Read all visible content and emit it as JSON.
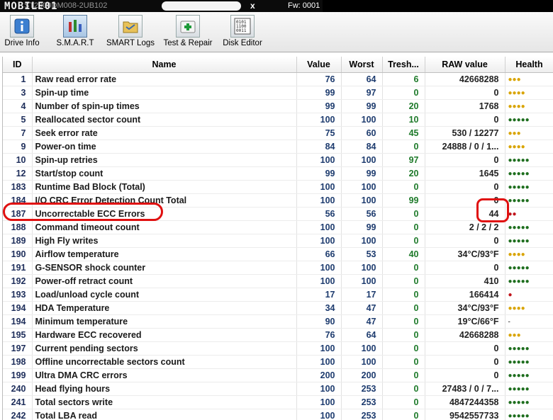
{
  "titlebar": {
    "logo": "MOBILE01",
    "device": "ST2000DM008-2UB102",
    "close_glyph": "x",
    "firmware": "Fw: 0001"
  },
  "toolbar": {
    "buttons": [
      {
        "label": "Drive Info",
        "icon": "info-icon"
      },
      {
        "label": "S.M.A.R.T",
        "icon": "smart-bars-icon"
      },
      {
        "label": "SMART Logs",
        "icon": "folder-icon"
      },
      {
        "label": "Test & Repair",
        "icon": "first-aid-icon"
      },
      {
        "label": "Disk Editor",
        "icon": "binary-editor-icon"
      }
    ]
  },
  "table": {
    "headers": [
      "ID",
      "Name",
      "Value",
      "Worst",
      "Tresh...",
      "RAW value",
      "Health"
    ],
    "rows": [
      {
        "id": "1",
        "name": "Raw read error rate",
        "value": "76",
        "worst": "64",
        "thresh": "6",
        "raw": "42668288",
        "health": "●●●",
        "hcolor": "yellow",
        "ncolor": "green"
      },
      {
        "id": "3",
        "name": "Spin-up time",
        "value": "99",
        "worst": "97",
        "thresh": "0",
        "raw": "0",
        "health": "●●●●",
        "hcolor": "yellow",
        "ncolor": "green"
      },
      {
        "id": "4",
        "name": "Number of spin-up times",
        "value": "99",
        "worst": "99",
        "thresh": "20",
        "raw": "1768",
        "health": "●●●●",
        "hcolor": "yellow",
        "ncolor": "black"
      },
      {
        "id": "5",
        "name": "Reallocated sector count",
        "value": "100",
        "worst": "100",
        "thresh": "10",
        "raw": "0",
        "health": "●●●●●",
        "hcolor": "green",
        "ncolor": "purple"
      },
      {
        "id": "7",
        "name": "Seek error rate",
        "value": "75",
        "worst": "60",
        "thresh": "45",
        "raw": "530 / 12277",
        "health": "●●●",
        "hcolor": "yellow",
        "ncolor": "green"
      },
      {
        "id": "9",
        "name": "Power-on time",
        "value": "84",
        "worst": "84",
        "thresh": "0",
        "raw": "24888 / 0 / 1...",
        "health": "●●●●",
        "hcolor": "yellow",
        "ncolor": "black"
      },
      {
        "id": "10",
        "name": "Spin-up retries",
        "value": "100",
        "worst": "100",
        "thresh": "97",
        "raw": "0",
        "health": "●●●●●",
        "hcolor": "green",
        "ncolor": "green"
      },
      {
        "id": "12",
        "name": "Start/stop count",
        "value": "99",
        "worst": "99",
        "thresh": "20",
        "raw": "1645",
        "health": "●●●●●",
        "hcolor": "green",
        "ncolor": "black"
      },
      {
        "id": "183",
        "name": "Runtime Bad Block (Total)",
        "value": "100",
        "worst": "100",
        "thresh": "0",
        "raw": "0",
        "health": "●●●●●",
        "hcolor": "green",
        "ncolor": "black"
      },
      {
        "id": "184",
        "name": "I/O CRC Error Detection Count Total",
        "value": "100",
        "worst": "100",
        "thresh": "99",
        "raw": "0",
        "health": "●●●●●",
        "hcolor": "green",
        "ncolor": "purple"
      },
      {
        "id": "187",
        "name": "Uncorrectable ECC Errors",
        "value": "56",
        "worst": "56",
        "thresh": "0",
        "raw": "44",
        "health": "●●",
        "hcolor": "red",
        "ncolor": "purple",
        "rawcolor": "red"
      },
      {
        "id": "188",
        "name": "Command timeout count",
        "value": "100",
        "worst": "99",
        "thresh": "0",
        "raw": "2 / 2 / 2",
        "health": "●●●●●",
        "hcolor": "green",
        "ncolor": "purple"
      },
      {
        "id": "189",
        "name": "High Fly writes",
        "value": "100",
        "worst": "100",
        "thresh": "0",
        "raw": "0",
        "health": "●●●●●",
        "hcolor": "green",
        "ncolor": "black"
      },
      {
        "id": "190",
        "name": "Airflow temperature",
        "value": "66",
        "worst": "53",
        "thresh": "40",
        "raw": "34°C/93°F",
        "health": "●●●●",
        "hcolor": "yellow",
        "ncolor": "blue"
      },
      {
        "id": "191",
        "name": "G-SENSOR shock counter",
        "value": "100",
        "worst": "100",
        "thresh": "0",
        "raw": "0",
        "health": "●●●●●",
        "hcolor": "green",
        "ncolor": "black"
      },
      {
        "id": "192",
        "name": "Power-off retract count",
        "value": "100",
        "worst": "100",
        "thresh": "0",
        "raw": "410",
        "health": "●●●●●",
        "hcolor": "green",
        "ncolor": "black"
      },
      {
        "id": "193",
        "name": "Load/unload cycle count",
        "value": "17",
        "worst": "17",
        "thresh": "0",
        "raw": "166414",
        "health": "●",
        "hcolor": "red",
        "ncolor": "black"
      },
      {
        "id": "194",
        "name": "HDA Temperature",
        "value": "34",
        "worst": "47",
        "thresh": "0",
        "raw": "34°C/93°F",
        "health": "●●●●",
        "hcolor": "yellow",
        "ncolor": "blue"
      },
      {
        "id": "194",
        "name": "Minimum temperature",
        "value": "90",
        "worst": "47",
        "thresh": "0",
        "raw": "19°C/66°F",
        "health": "-",
        "hcolor": "gray",
        "ncolor": "blue"
      },
      {
        "id": "195",
        "name": "Hardware ECC recovered",
        "value": "76",
        "worst": "64",
        "thresh": "0",
        "raw": "42668288",
        "health": "●●●",
        "hcolor": "yellow",
        "ncolor": "black"
      },
      {
        "id": "197",
        "name": "Current pending sectors",
        "value": "100",
        "worst": "100",
        "thresh": "0",
        "raw": "0",
        "health": "●●●●●",
        "hcolor": "green",
        "ncolor": "purple"
      },
      {
        "id": "198",
        "name": "Offline uncorrectable sectors count",
        "value": "100",
        "worst": "100",
        "thresh": "0",
        "raw": "0",
        "health": "●●●●●",
        "hcolor": "green",
        "ncolor": "purple"
      },
      {
        "id": "199",
        "name": "Ultra DMA CRC errors",
        "value": "200",
        "worst": "200",
        "thresh": "0",
        "raw": "0",
        "health": "●●●●●",
        "hcolor": "green",
        "ncolor": "black"
      },
      {
        "id": "240",
        "name": "Head flying hours",
        "value": "100",
        "worst": "253",
        "thresh": "0",
        "raw": "27483 / 0 / 7...",
        "health": "●●●●●",
        "hcolor": "green",
        "ncolor": "black"
      },
      {
        "id": "241",
        "name": "Total sectors write",
        "value": "100",
        "worst": "253",
        "thresh": "0",
        "raw": "4847244358",
        "health": "●●●●●",
        "hcolor": "green",
        "ncolor": "black"
      },
      {
        "id": "242",
        "name": "Total LBA read",
        "value": "100",
        "worst": "253",
        "thresh": "0",
        "raw": "9542557733",
        "health": "●●●●●",
        "hcolor": "green",
        "ncolor": "black"
      }
    ]
  },
  "colors": {
    "annotation_red": "#e01010",
    "health_yellow": "#d9a400",
    "health_green": "#1e6e1e",
    "health_red": "#c0141b"
  }
}
